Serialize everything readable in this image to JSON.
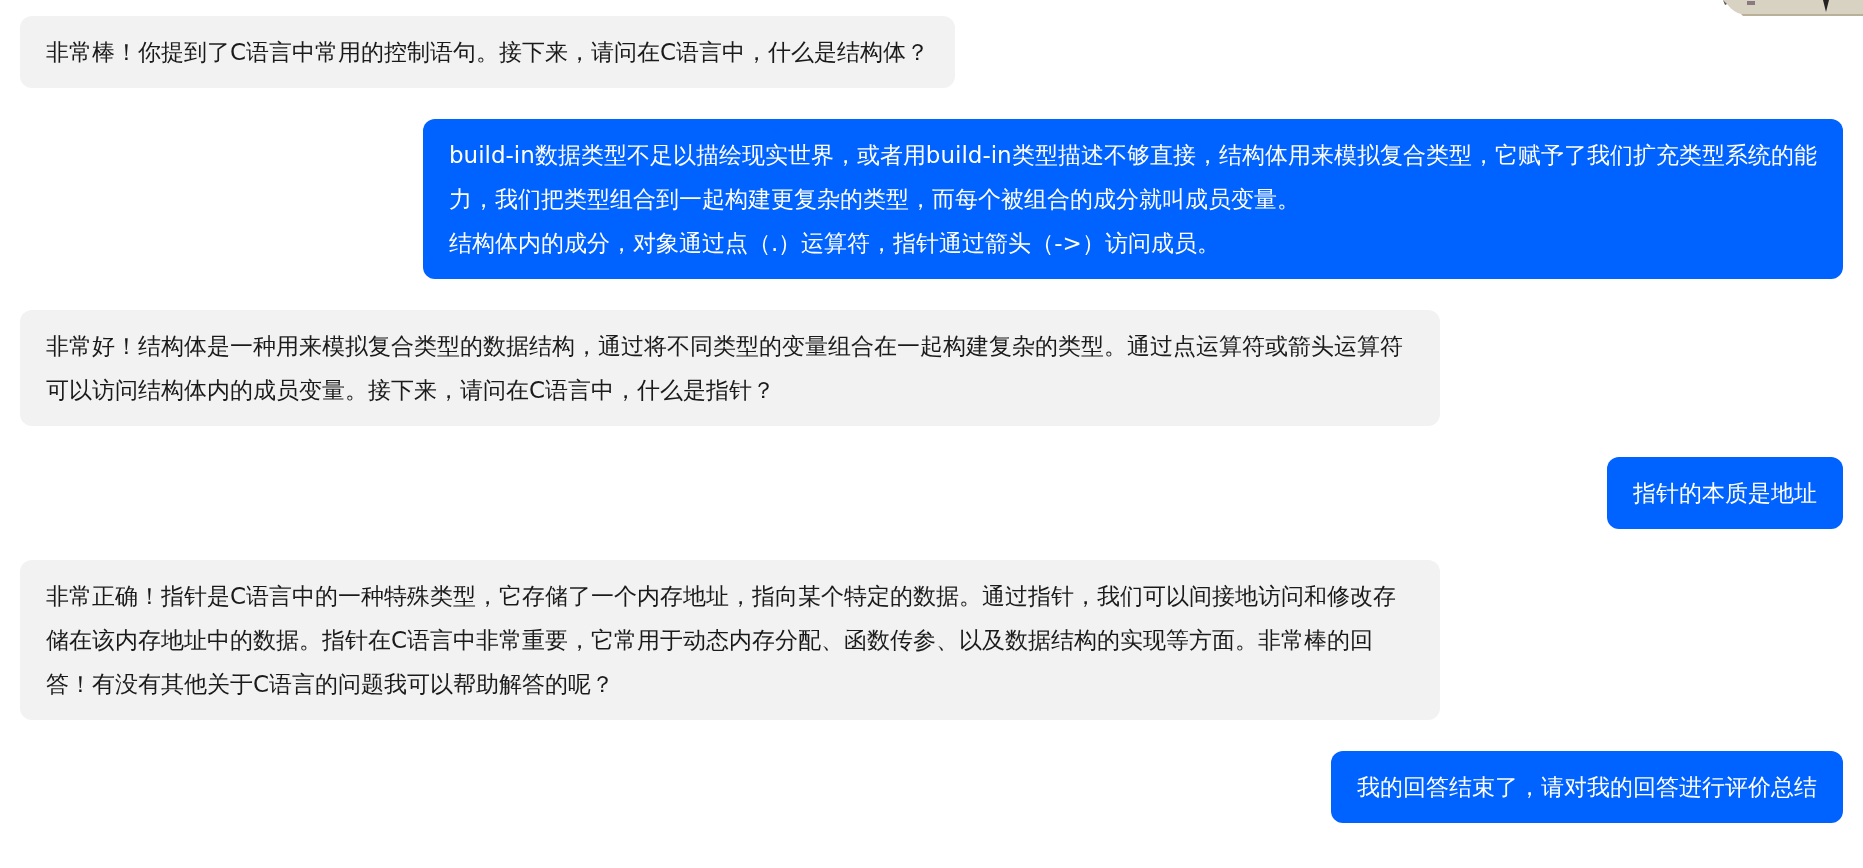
{
  "messages": [
    {
      "kind": "assistant",
      "paragraphs": [
        "非常棒！你提到了C语言中常用的控制语句。接下来，请问在C语言中，什么是结构体？"
      ]
    },
    {
      "kind": "user",
      "paragraphs": [
        "build-in数据类型不足以描绘现实世界，或者用build-in类型描述不够直接，结构体用来模拟复合类型，它赋予了我们扩充类型系统的能力，我们把类型组合到一起构建更复杂的类型，而每个被组合的成分就叫成员变量。",
        "结构体内的成分，对象通过点（.）运算符，指针通过箭头（->）访问成员。"
      ]
    },
    {
      "kind": "assistant",
      "paragraphs": [
        "非常好！结构体是一种用来模拟复合类型的数据结构，通过将不同类型的变量组合在一起构建复杂的类型。通过点运算符或箭头运算符可以访问结构体内的成员变量。接下来，请问在C语言中，什么是指针？"
      ]
    },
    {
      "kind": "user",
      "paragraphs": [
        "指针的本质是地址"
      ]
    },
    {
      "kind": "assistant",
      "paragraphs": [
        "非常正确！指针是C语言中的一种特殊类型，它存储了一个内存地址，指向某个特定的数据。通过指针，我们可以间接地访问和修改存储在该内存地址中的数据。指针在C语言中非常重要，它常用于动态内存分配、函数传参、以及数据结构的实现等方面。非常棒的回答！有没有其他关于C语言的问题我可以帮助解答的呢？"
      ]
    },
    {
      "kind": "user",
      "paragraphs": [
        "我的回答结束了，请对我的回答进行评价总结"
      ]
    }
  ]
}
